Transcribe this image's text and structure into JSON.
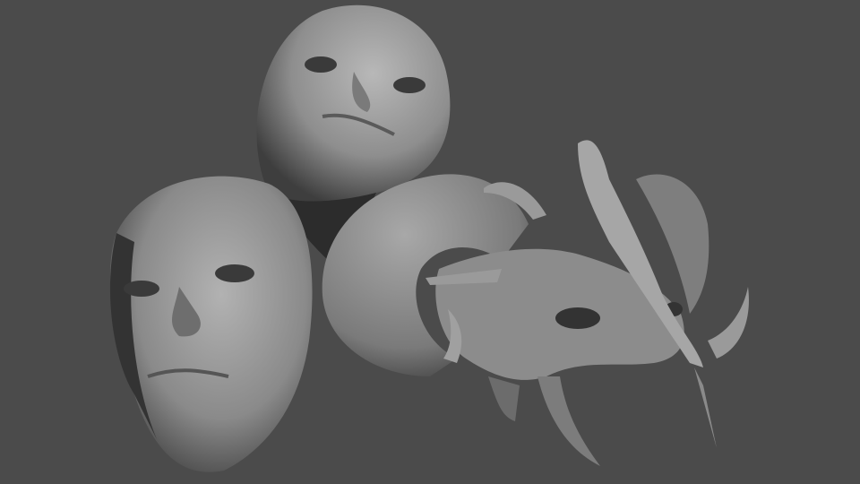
{
  "scene": {
    "subject": "three-sculpted-masks",
    "colors": {
      "background": "#4b4b4b",
      "surface_light": "#b4b4b4",
      "surface_mid": "#8a8a8a",
      "surface_dark": "#3a3a3a",
      "shadow": "#2c2c2c"
    }
  }
}
